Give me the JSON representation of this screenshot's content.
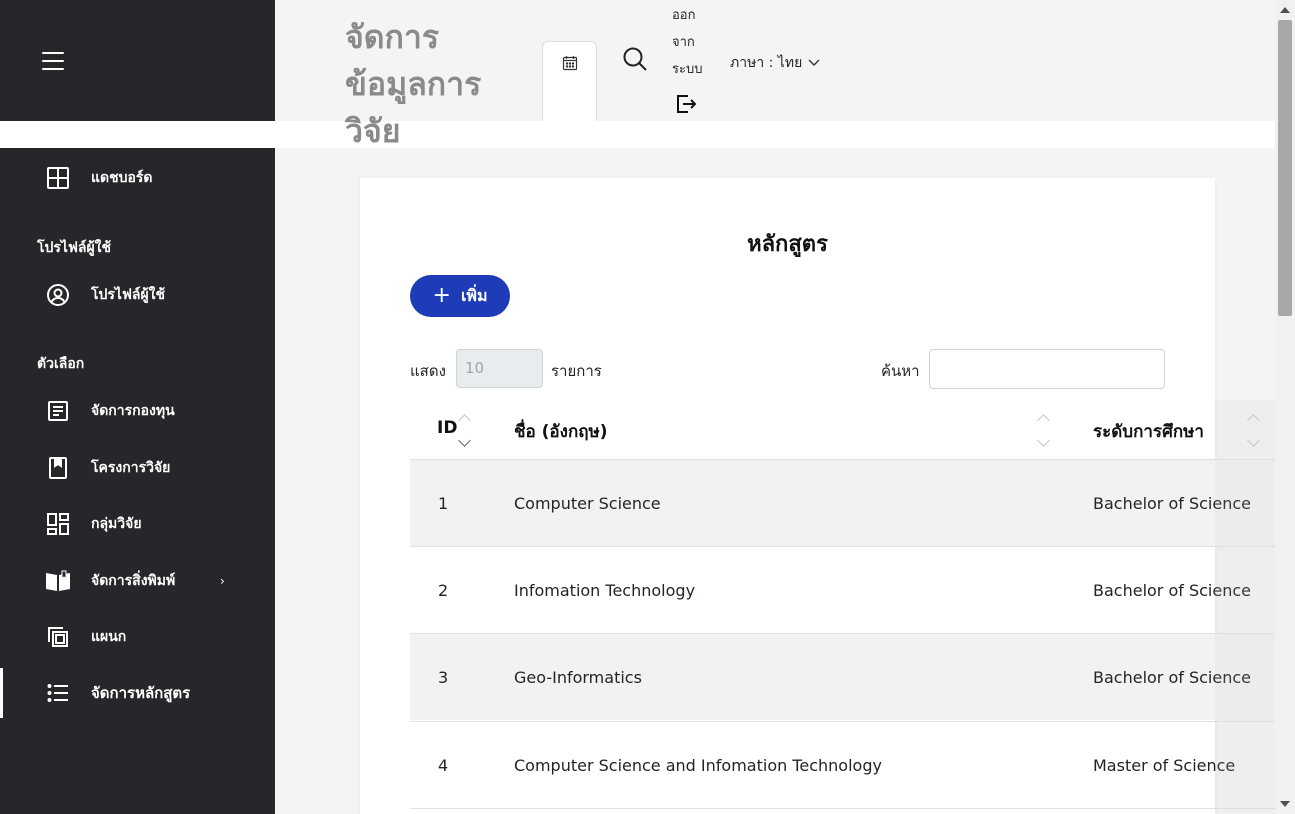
{
  "header": {
    "app_title": "จัดการข้อมูลการวิจัย",
    "logout_label": "ออกจากระบบ",
    "language_label": "ภาษา : ไทย"
  },
  "sidebar": {
    "dashboard": "แดชบอร์ด",
    "profile_section": "โปรไฟล์ผู้ใช้",
    "profile_item": "โปรไฟล์ผู้ใช้",
    "options_section": "ตัวเลือก",
    "items": [
      {
        "label": "จัดการกองทุน",
        "icon": "document-icon"
      },
      {
        "label": "โครงการวิจัย",
        "icon": "bookmark-icon"
      },
      {
        "label": "กลุ่มวิจัย",
        "icon": "dashboard-grid-icon"
      },
      {
        "label": "จัดการสิ่งพิมพ์",
        "icon": "book-open-icon"
      },
      {
        "label": "แผนก",
        "icon": "copy-icon"
      },
      {
        "label": "จัดการหลักสูตร",
        "icon": "list-icon"
      }
    ]
  },
  "main": {
    "title": "หลักสูตร",
    "add_button": "เพิ่ม",
    "show_label": "แสดง",
    "page_length": "10",
    "entries_label": "รายการ",
    "search_label": "ค้นหา",
    "columns": [
      "ID",
      "ชื่อ (อังกฤษ)",
      "ระดับการศึกษา"
    ],
    "rows": [
      {
        "id": "1",
        "name": "Computer Science",
        "level": "Bachelor of Science"
      },
      {
        "id": "2",
        "name": "Infomation Technology",
        "level": "Bachelor of Science"
      },
      {
        "id": "3",
        "name": "Geo-Informatics",
        "level": "Bachelor of Science"
      },
      {
        "id": "4",
        "name": "Computer Science and Infomation Technology",
        "level": "Master of Science"
      }
    ]
  },
  "colors": {
    "sidebar_bg": "#27272b",
    "accent": "#1f3cb8",
    "page_bg": "#f3f4f6"
  }
}
